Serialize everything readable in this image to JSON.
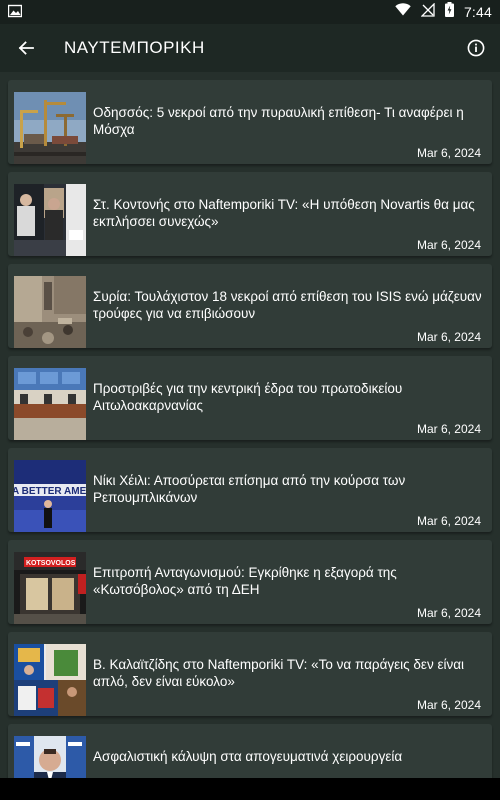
{
  "status_bar": {
    "time": "7:44"
  },
  "app_bar": {
    "title": "ΝΑΥΤΕΜΠΟΡΙΚΗ"
  },
  "articles": [
    {
      "title": "Οδησσός: 5 νεκροί από την πυραυλική επίθεση- Τι αναφέρει η Μόσχα",
      "date": "Mar 6, 2024"
    },
    {
      "title": "Στ. Κοντονής στο Naftemporiki TV: «Η υπόθεση Novartis θα μας εκπλήσσει συνεχώς»",
      "date": "Mar 6, 2024"
    },
    {
      "title": "Συρία: Τουλάχιστον 18 νεκροί από επίθεση του ISIS ενώ μάζευαν τρούφες για να επιβιώσουν",
      "date": "Mar 6, 2024"
    },
    {
      "title": "Προστριβές για την κεντρική έδρα του πρωτοδικείου Αιτωλοακαρνανίας",
      "date": "Mar 6, 2024"
    },
    {
      "title": "Νίκι Χέιλι: Αποσύρεται επίσημα από την κούρσα των Ρεπουμπλικάνων",
      "date": "Mar 6, 2024"
    },
    {
      "title": "Επιτροπή Ανταγωνισμού: Εγκρίθηκε η εξαγορά της «Κωτσόβολος» από τη ΔΕΗ",
      "date": "Mar 6, 2024"
    },
    {
      "title": "Β. Καλαϊτζίδης στο Naftemporiki TV: «Το να παράγεις δεν είναι απλό, δεν είναι εύκολο»",
      "date": "Mar 6, 2024"
    },
    {
      "title": "Ασφαλιστική κάλυψη στα απογευματινά χειρουργεία",
      "date": ""
    }
  ],
  "thumbnail_texts": {
    "article_5": "A BETTER AMERICA",
    "article_6": "KOTSOVOLOS"
  }
}
